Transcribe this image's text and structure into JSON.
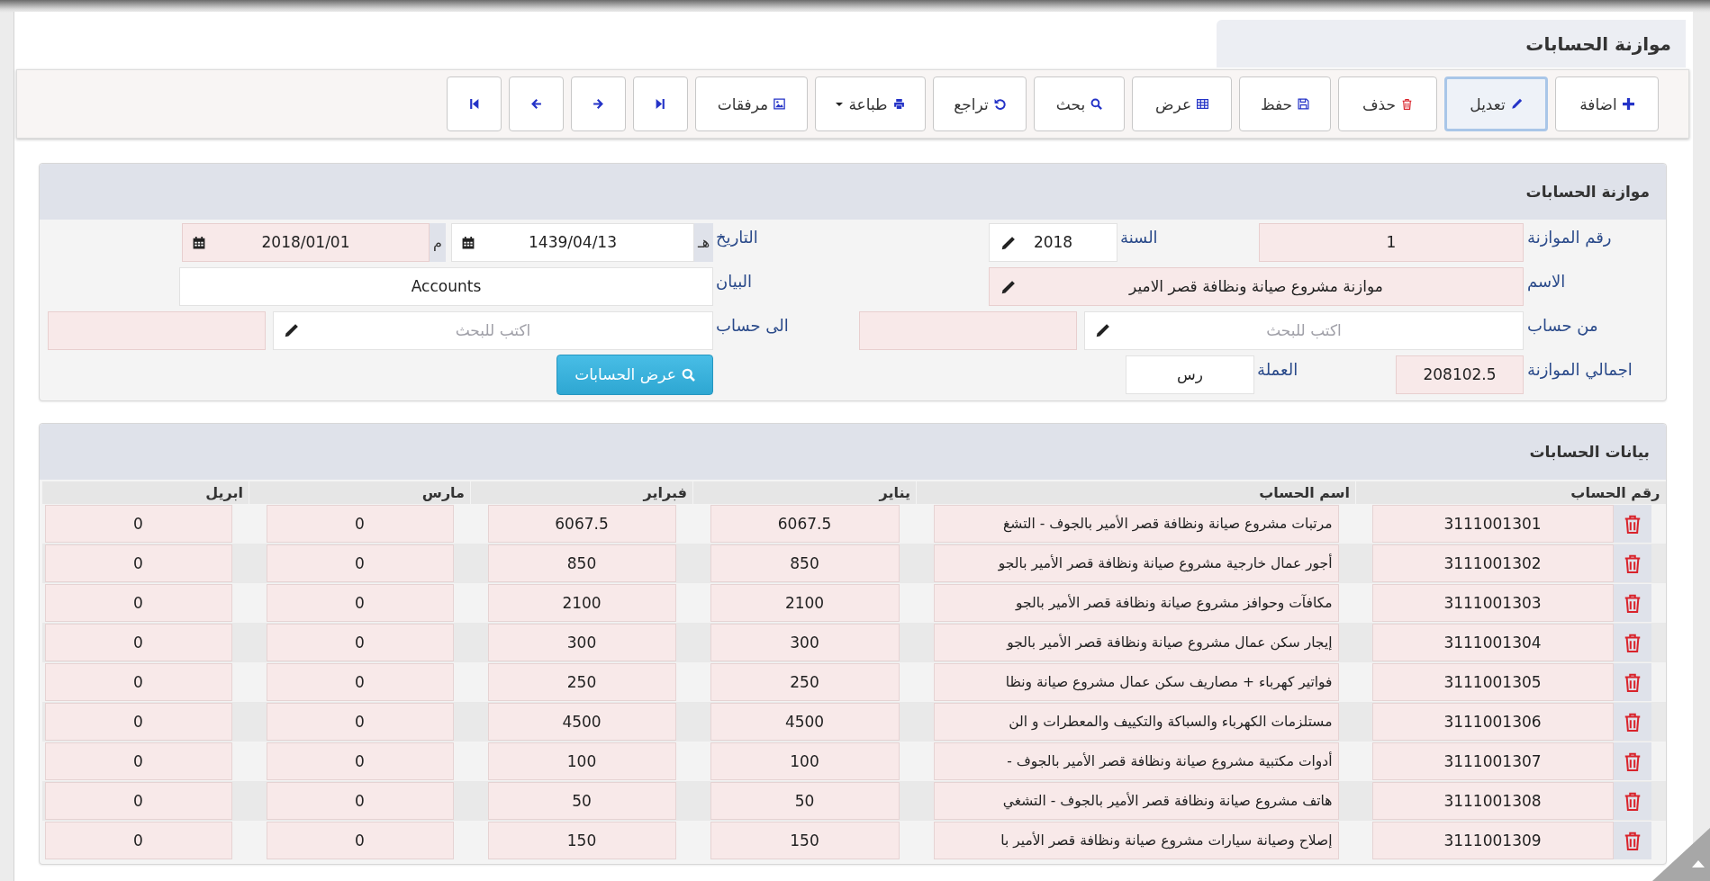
{
  "page_title": "موازنة الحسابات",
  "toolbar": [
    {
      "label": "اضافة",
      "selected": false
    },
    {
      "label": "تعديل",
      "selected": true
    },
    {
      "label": "حذف",
      "selected": false
    },
    {
      "label": "حفظ",
      "selected": false
    },
    {
      "label": "عرض",
      "selected": false
    },
    {
      "label": "بحث",
      "selected": false
    },
    {
      "label": "تراجع",
      "selected": false
    },
    {
      "label": "طباعة",
      "selected": false
    },
    {
      "label": "مرفقات",
      "selected": false
    }
  ],
  "form": {
    "title": "موازنة الحسابات",
    "budget_number": {
      "label": "رقم الموازنة",
      "value": "1",
      "readonly": true
    },
    "year": {
      "label": "السنة",
      "value": "2018",
      "readonly": false
    },
    "name": {
      "label": "الاسم",
      "value": "موازنة مشروع صيانة ونظافة قصر الامير",
      "readonly": true
    },
    "from_account": {
      "label": "من حساب",
      "placeholder": "اكتب للبحث"
    },
    "total": {
      "label": "اجمالي الموازنة",
      "value": "208102.5",
      "readonly": true
    },
    "currency": {
      "label": "العملة",
      "value": "رس",
      "readonly": false
    },
    "date": {
      "label": "التاريخ",
      "hijri_suffix": "هـ",
      "hijri": "1439/04/13",
      "gregorian_suffix": "م",
      "gregorian": "2018/01/01"
    },
    "statement": {
      "label": "البيان",
      "value": "Accounts",
      "readonly": false
    },
    "to_account": {
      "label": "الى حساب",
      "placeholder": "اكتب للبحث"
    },
    "show_button": "عرض الحسابات"
  },
  "table": {
    "title": "بيانات الحسابات",
    "columns": [
      "رقم الحساب",
      "اسم الحساب",
      "يناير",
      "فبراير",
      "مارس",
      "ابريل"
    ],
    "rows": [
      {
        "account": "3111001301",
        "name": "مرتبات مشروع صيانة ونظافة قصر الأمير بالجوف - التشغ",
        "values": [
          "6067.5",
          "6067.5",
          "0",
          "0"
        ]
      },
      {
        "account": "3111001302",
        "name": "أجور عمال خارجية مشروع صيانة ونظافة قصر الأمير بالجو",
        "values": [
          "850",
          "850",
          "0",
          "0"
        ]
      },
      {
        "account": "3111001303",
        "name": "مكافآت وحوافز مشروع صيانة ونظافة قصر الأمير بالجو",
        "values": [
          "2100",
          "2100",
          "0",
          "0"
        ]
      },
      {
        "account": "3111001304",
        "name": "إيجار سكن عمال مشروع صيانة ونظافة قصر الأمير بالجو",
        "values": [
          "300",
          "300",
          "0",
          "0"
        ]
      },
      {
        "account": "3111001305",
        "name": "فواتير كهرباء + مصاريف سكن عمال مشروع صيانة ونظا",
        "values": [
          "250",
          "250",
          "0",
          "0"
        ]
      },
      {
        "account": "3111001306",
        "name": "مستلزمات الكهرباء والسباكة والتكييف والمعطرات و الن",
        "values": [
          "4500",
          "4500",
          "0",
          "0"
        ]
      },
      {
        "account": "3111001307",
        "name": "أدوات مكتبية مشروع صيانة ونظافة قصر الأمير بالجوف -",
        "values": [
          "100",
          "100",
          "0",
          "0"
        ]
      },
      {
        "account": "3111001308",
        "name": "هاتف مشروع صيانة ونظافة قصر الأمير بالجوف - التشغي",
        "values": [
          "50",
          "50",
          "0",
          "0"
        ]
      },
      {
        "account": "3111001309",
        "name": "إصلاح وصيانة سيارات مشروع صيانة ونظافة قصر الأمير با",
        "values": [
          "150",
          "150",
          "0",
          "0"
        ]
      }
    ]
  }
}
